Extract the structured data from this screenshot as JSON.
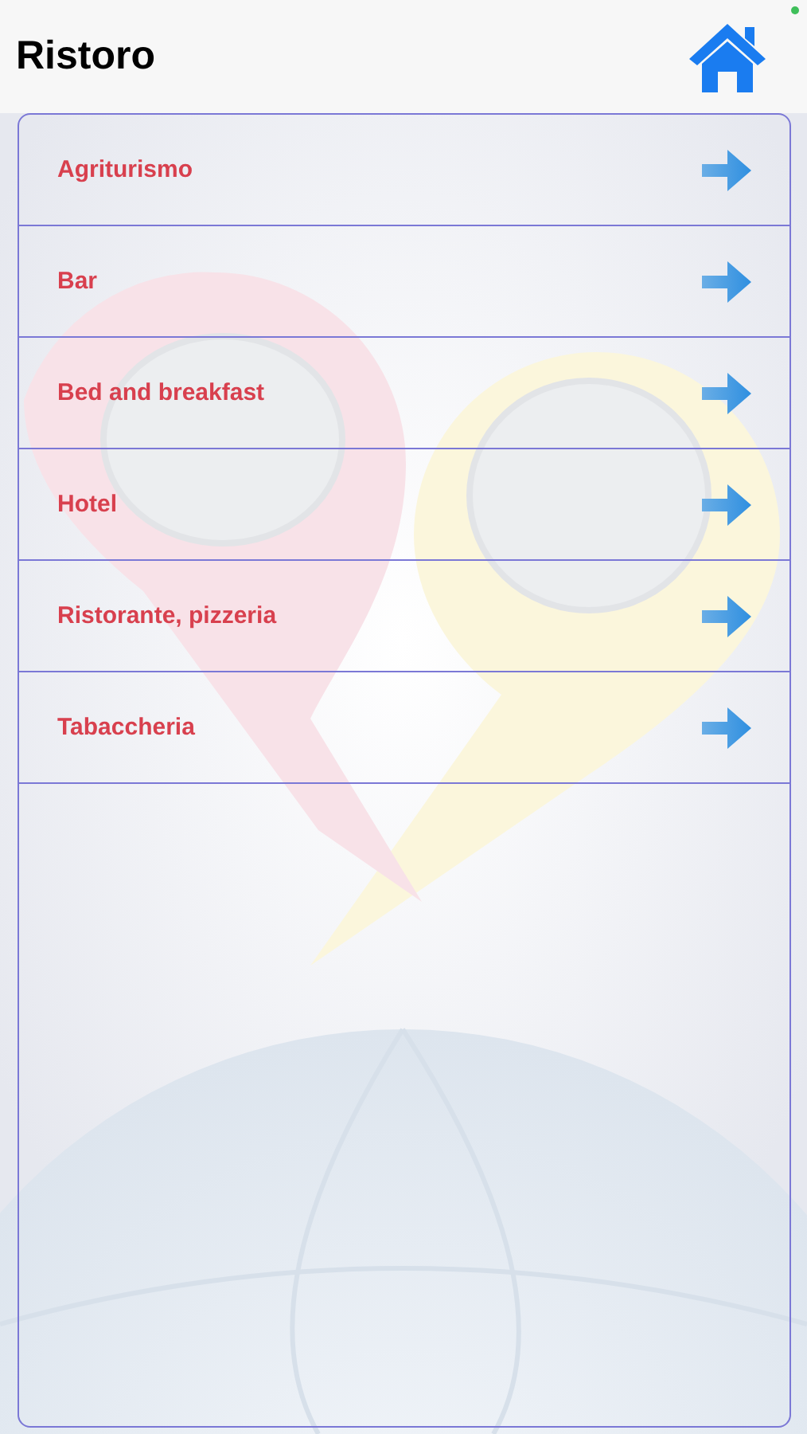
{
  "header": {
    "title": "Ristoro"
  },
  "menu": {
    "items": [
      {
        "label": "Agriturismo"
      },
      {
        "label": "Bar"
      },
      {
        "label": "Bed and breakfast"
      },
      {
        "label": "Hotel"
      },
      {
        "label": "Ristorante, pizzeria"
      },
      {
        "label": "Tabaccheria"
      }
    ]
  }
}
